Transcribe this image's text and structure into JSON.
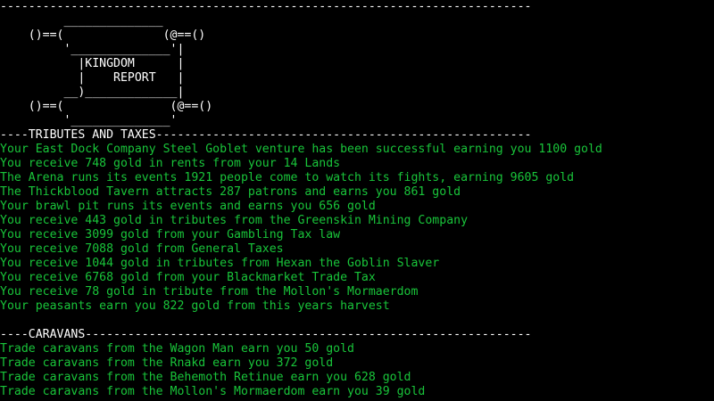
{
  "colors": {
    "background": "#000000",
    "header_text": "#ffffff",
    "body_text": "#19c53a"
  },
  "top_rule": "---------------------------------------------------------------------------",
  "banner_art": "         ______________\n    ()==(              (@==()\n         '______________'|\n           |KINGDOM      |\n           |    REPORT   |\n         __)_____________|\n    ()==(               (@==()\n         '______________'",
  "tributes": {
    "header": "----TRIBUTES AND TAXES-----------------------------------------------------",
    "lines": [
      "Your East Dock Company Steel Goblet venture has been successful earning you 1100 gold",
      "You receive 748 gold in rents from your 14 Lands",
      "The Arena runs its events 1921 people come to watch its fights, earning 9605 gold",
      "The Thickblood Tavern attracts 287 patrons and earns you 861 gold",
      "Your brawl pit runs its events and earns you 656 gold",
      "You receive 443 gold in tributes from the Greenskin Mining Company",
      "You receive 3099 gold from your Gambling Tax law",
      "You receive 7088 gold from General Taxes",
      "You receive 1044 gold in tributes from Hexan the Goblin Slaver",
      "You receive 6768 gold from your Blackmarket Trade Tax",
      "You receive 78 gold in tribute from the Mollon's Mormaerdom",
      "Your peasants earn you 822 gold from this years harvest"
    ]
  },
  "caravans": {
    "header": "----CARAVANS---------------------------------------------------------------",
    "lines": [
      "Trade caravans from the Wagon Man earn you 50 gold",
      "Trade caravans from the Rnakd earn you 372 gold",
      "Trade caravans from the Behemoth Retinue earn you 628 gold",
      "Trade caravans from the Mollon's Mormaerdom earn you 39 gold"
    ]
  }
}
